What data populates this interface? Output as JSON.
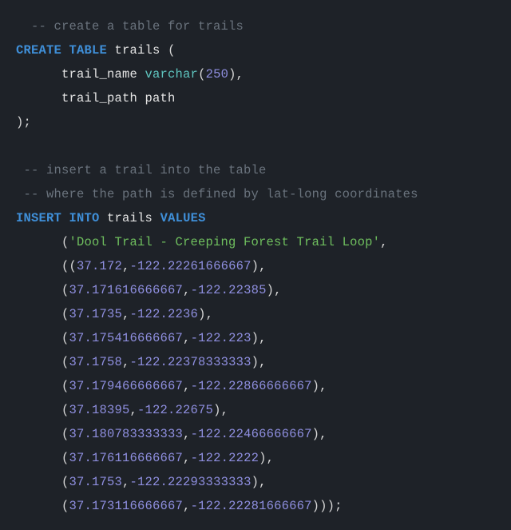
{
  "code": {
    "tokens": [
      [
        {
          "t": "  ",
          "c": "punct"
        },
        {
          "t": "-- create a table for trails",
          "c": "comment"
        }
      ],
      [
        {
          "t": "CREATE TABLE",
          "c": "keyword"
        },
        {
          "t": " ",
          "c": "punct"
        },
        {
          "t": "trails",
          "c": "ident"
        },
        {
          "t": " (",
          "c": "punct"
        }
      ],
      [
        {
          "t": "      ",
          "c": "punct"
        },
        {
          "t": "trail_name",
          "c": "ident"
        },
        {
          "t": " ",
          "c": "punct"
        },
        {
          "t": "varchar",
          "c": "func"
        },
        {
          "t": "(",
          "c": "punct"
        },
        {
          "t": "250",
          "c": "number"
        },
        {
          "t": "),",
          "c": "punct"
        }
      ],
      [
        {
          "t": "      ",
          "c": "punct"
        },
        {
          "t": "trail_path",
          "c": "ident"
        },
        {
          "t": " ",
          "c": "punct"
        },
        {
          "t": "path",
          "c": "ident"
        }
      ],
      [
        {
          "t": ");",
          "c": "punct"
        }
      ],
      [
        {
          "t": " ",
          "c": "punct"
        }
      ],
      [
        {
          "t": " ",
          "c": "punct"
        },
        {
          "t": "-- insert a trail into the table",
          "c": "comment"
        }
      ],
      [
        {
          "t": " ",
          "c": "punct"
        },
        {
          "t": "-- where the path is defined by lat-long coordinates",
          "c": "comment"
        }
      ],
      [
        {
          "t": "INSERT INTO",
          "c": "keyword"
        },
        {
          "t": " ",
          "c": "punct"
        },
        {
          "t": "trails",
          "c": "ident"
        },
        {
          "t": " ",
          "c": "punct"
        },
        {
          "t": "VALUES",
          "c": "keyword"
        }
      ],
      [
        {
          "t": "      (",
          "c": "punct"
        },
        {
          "t": "'Dool Trail - Creeping Forest Trail Loop'",
          "c": "string"
        },
        {
          "t": ",",
          "c": "punct"
        }
      ],
      [
        {
          "t": "      ((",
          "c": "punct"
        },
        {
          "t": "37.172",
          "c": "number"
        },
        {
          "t": ",",
          "c": "punct"
        },
        {
          "t": "-122.22261666667",
          "c": "number"
        },
        {
          "t": "),",
          "c": "punct"
        }
      ],
      [
        {
          "t": "      (",
          "c": "punct"
        },
        {
          "t": "37.171616666667",
          "c": "number"
        },
        {
          "t": ",",
          "c": "punct"
        },
        {
          "t": "-122.22385",
          "c": "number"
        },
        {
          "t": "),",
          "c": "punct"
        }
      ],
      [
        {
          "t": "      (",
          "c": "punct"
        },
        {
          "t": "37.1735",
          "c": "number"
        },
        {
          "t": ",",
          "c": "punct"
        },
        {
          "t": "-122.2236",
          "c": "number"
        },
        {
          "t": "),",
          "c": "punct"
        }
      ],
      [
        {
          "t": "      (",
          "c": "punct"
        },
        {
          "t": "37.175416666667",
          "c": "number"
        },
        {
          "t": ",",
          "c": "punct"
        },
        {
          "t": "-122.223",
          "c": "number"
        },
        {
          "t": "),",
          "c": "punct"
        }
      ],
      [
        {
          "t": "      (",
          "c": "punct"
        },
        {
          "t": "37.1758",
          "c": "number"
        },
        {
          "t": ",",
          "c": "punct"
        },
        {
          "t": "-122.22378333333",
          "c": "number"
        },
        {
          "t": "),",
          "c": "punct"
        }
      ],
      [
        {
          "t": "      (",
          "c": "punct"
        },
        {
          "t": "37.179466666667",
          "c": "number"
        },
        {
          "t": ",",
          "c": "punct"
        },
        {
          "t": "-122.22866666667",
          "c": "number"
        },
        {
          "t": "),",
          "c": "punct"
        }
      ],
      [
        {
          "t": "      (",
          "c": "punct"
        },
        {
          "t": "37.18395",
          "c": "number"
        },
        {
          "t": ",",
          "c": "punct"
        },
        {
          "t": "-122.22675",
          "c": "number"
        },
        {
          "t": "),",
          "c": "punct"
        }
      ],
      [
        {
          "t": "      (",
          "c": "punct"
        },
        {
          "t": "37.180783333333",
          "c": "number"
        },
        {
          "t": ",",
          "c": "punct"
        },
        {
          "t": "-122.22466666667",
          "c": "number"
        },
        {
          "t": "),",
          "c": "punct"
        }
      ],
      [
        {
          "t": "      (",
          "c": "punct"
        },
        {
          "t": "37.176116666667",
          "c": "number"
        },
        {
          "t": ",",
          "c": "punct"
        },
        {
          "t": "-122.2222",
          "c": "number"
        },
        {
          "t": "),",
          "c": "punct"
        }
      ],
      [
        {
          "t": "      (",
          "c": "punct"
        },
        {
          "t": "37.1753",
          "c": "number"
        },
        {
          "t": ",",
          "c": "punct"
        },
        {
          "t": "-122.22293333333",
          "c": "number"
        },
        {
          "t": "),",
          "c": "punct"
        }
      ],
      [
        {
          "t": "      (",
          "c": "punct"
        },
        {
          "t": "37.173116666667",
          "c": "number"
        },
        {
          "t": ",",
          "c": "punct"
        },
        {
          "t": "-122.22281666667",
          "c": "number"
        },
        {
          "t": ")));",
          "c": "punct"
        }
      ]
    ]
  }
}
